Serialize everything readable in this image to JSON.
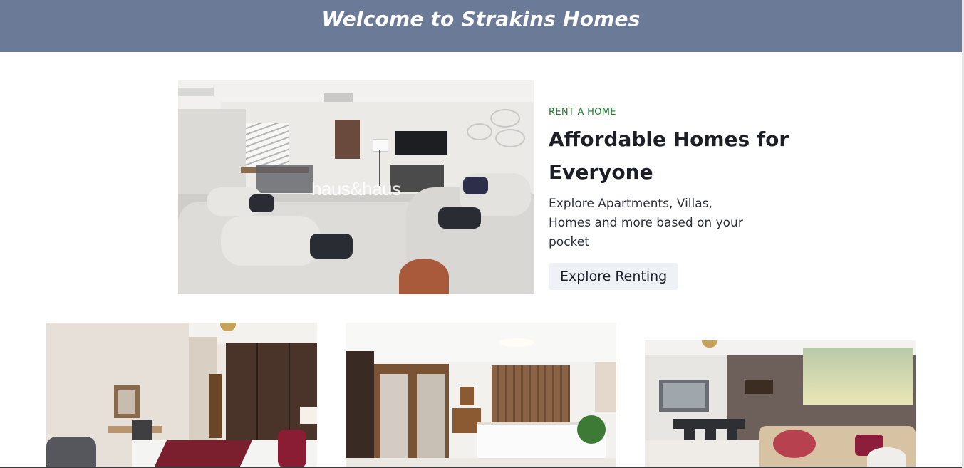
{
  "header": {
    "title": "Welcome to Strakins Homes"
  },
  "hero": {
    "eyebrow": "RENT A HOME",
    "title_line1": "Affordable Homes for",
    "title_line2": "Everyone",
    "description": "Explore Apartments, Villas, Homes and more based on your pocket",
    "button_label": "Explore Renting",
    "image_watermark": "haus&haus"
  },
  "listings": [
    {
      "image": "bedroom-with-wardrobe-photo"
    },
    {
      "image": "bedroom-with-mirror-wardrobe-photo"
    },
    {
      "image": "living-dining-room-photo"
    }
  ],
  "colors": {
    "header_bg": "#6b7a96",
    "eyebrow": "#1e7a2e",
    "button_bg": "#eef1f5"
  }
}
